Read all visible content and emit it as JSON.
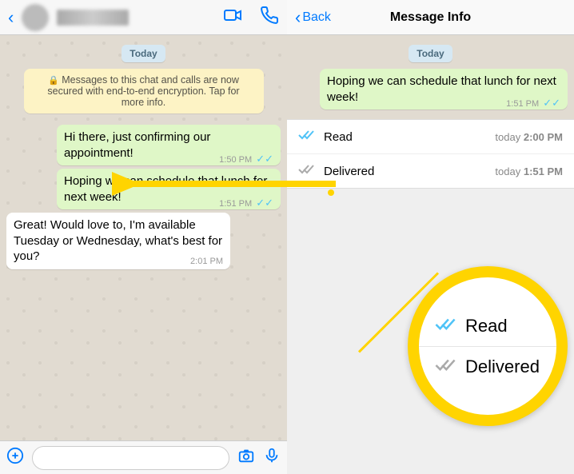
{
  "chat": {
    "date_label": "Today",
    "encryption_notice": "Messages to this chat and calls are now secured with end-to-end encryption. Tap for more info.",
    "messages": [
      {
        "text": "Hi there, just confirming our appointment!",
        "time": "1:50 PM",
        "outgoing": true
      },
      {
        "text": "Hoping we can schedule that lunch for next week!",
        "time": "1:51 PM",
        "outgoing": true
      },
      {
        "text": "Great!  Would love to, I'm available Tuesday or Wednesday, what's best for you?",
        "time": "2:01 PM",
        "outgoing": false
      }
    ]
  },
  "info": {
    "back_label": "Back",
    "title": "Message Info",
    "date_label": "Today",
    "selected_message": {
      "text": "Hoping we can schedule that lunch for next week!",
      "time": "1:51 PM"
    },
    "rows": [
      {
        "label": "Read",
        "when": "today",
        "time": "2:00 PM",
        "tick_color": "#4fc3f7"
      },
      {
        "label": "Delivered",
        "when": "today",
        "time": "1:51 PM",
        "tick_color": "#aaa"
      }
    ]
  },
  "magnifier": {
    "rows": [
      {
        "label": "Read",
        "tick_color": "#4fc3f7"
      },
      {
        "label": "Delivered",
        "tick_color": "#aaa"
      }
    ]
  },
  "icons": {
    "back_chevron": "‹",
    "lock": "🔒"
  }
}
